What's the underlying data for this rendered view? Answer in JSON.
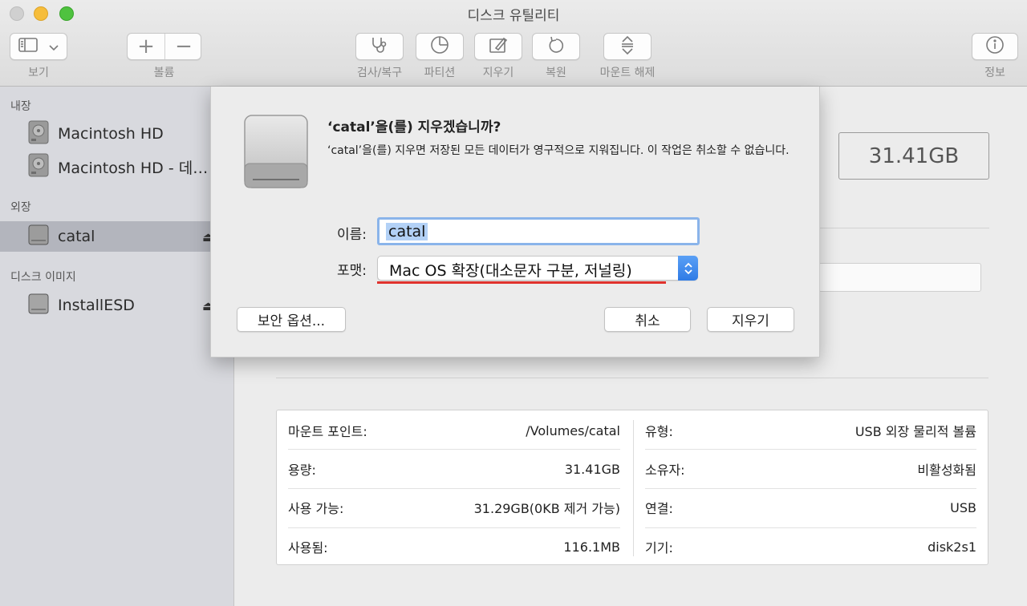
{
  "window": {
    "title": "디스크 유틸리티"
  },
  "toolbar": {
    "view_label": "보기",
    "volume_label": "볼륨",
    "firstaid_label": "검사/복구",
    "partition_label": "파티션",
    "erase_label": "지우기",
    "restore_label": "복원",
    "unmount_label": "마운트 해제",
    "info_label": "정보",
    "add_symbol": "+",
    "remove_symbol": "−"
  },
  "sidebar": {
    "internal_header": "내장",
    "external_header": "외장",
    "images_header": "디스크 이미지",
    "internal": [
      {
        "label": "Macintosh HD"
      },
      {
        "label": "Macintosh HD - 데…"
      }
    ],
    "external": [
      {
        "label": "catal",
        "eject": "⏏"
      }
    ],
    "images": [
      {
        "label": "InstallESD",
        "eject": "⏏"
      }
    ]
  },
  "main": {
    "capacity": "31.41GB",
    "info": {
      "left": [
        {
          "key": "마운트 포인트:",
          "value": "/Volumes/catal"
        },
        {
          "key": "용량:",
          "value": "31.41GB"
        },
        {
          "key": "사용 가능:",
          "value": "31.29GB(0KB 제거 가능)"
        },
        {
          "key": "사용됨:",
          "value": "116.1MB"
        }
      ],
      "right": [
        {
          "key": "유형:",
          "value": "USB 외장 물리적 볼륨"
        },
        {
          "key": "소유자:",
          "value": "비활성화됨"
        },
        {
          "key": "연결:",
          "value": "USB"
        },
        {
          "key": "기기:",
          "value": "disk2s1"
        }
      ]
    }
  },
  "dialog": {
    "title": "‘catal’을(를) 지우겠습니까?",
    "message": "‘catal’을(를) 지우면 저장된 모든 데이터가 영구적으로 지워집니다. 이 작업은 취소할 수 없습니다.",
    "name_label": "이름:",
    "name_value": "catal",
    "format_label": "포맷:",
    "format_value": "Mac OS 확장(대소문자 구분, 저널링)",
    "security_button": "보안 옵션...",
    "cancel_button": "취소",
    "erase_button": "지우기"
  },
  "colors": {
    "accent_blue": "#2f7be5",
    "highlight_underline": "#e0322d",
    "sidebar_selected": "#b3b5bd"
  }
}
